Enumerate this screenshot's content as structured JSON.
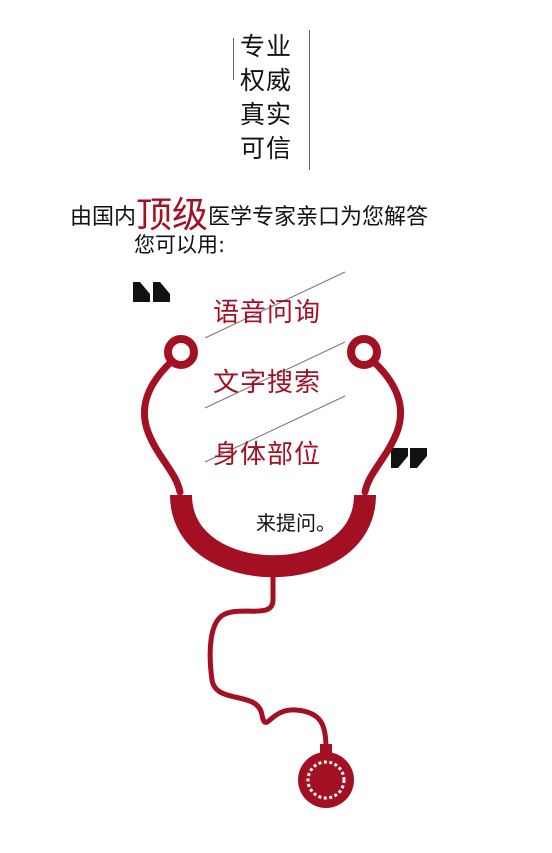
{
  "tagline": [
    "专业",
    "权威",
    "真实",
    "可信"
  ],
  "intro": {
    "before": "由国内",
    "highlight": "顶级",
    "after": "医学专家亲口为您解答",
    "line2": "您可以用:"
  },
  "options": [
    "语音问询",
    "文字搜索",
    "身体部位"
  ],
  "closing": "来提问。",
  "colors": {
    "accent": "#a30f23",
    "text": "#111111",
    "background": "#ffffff"
  },
  "icons": [
    "quote-open-icon",
    "quote-close-icon",
    "stethoscope-icon"
  ]
}
